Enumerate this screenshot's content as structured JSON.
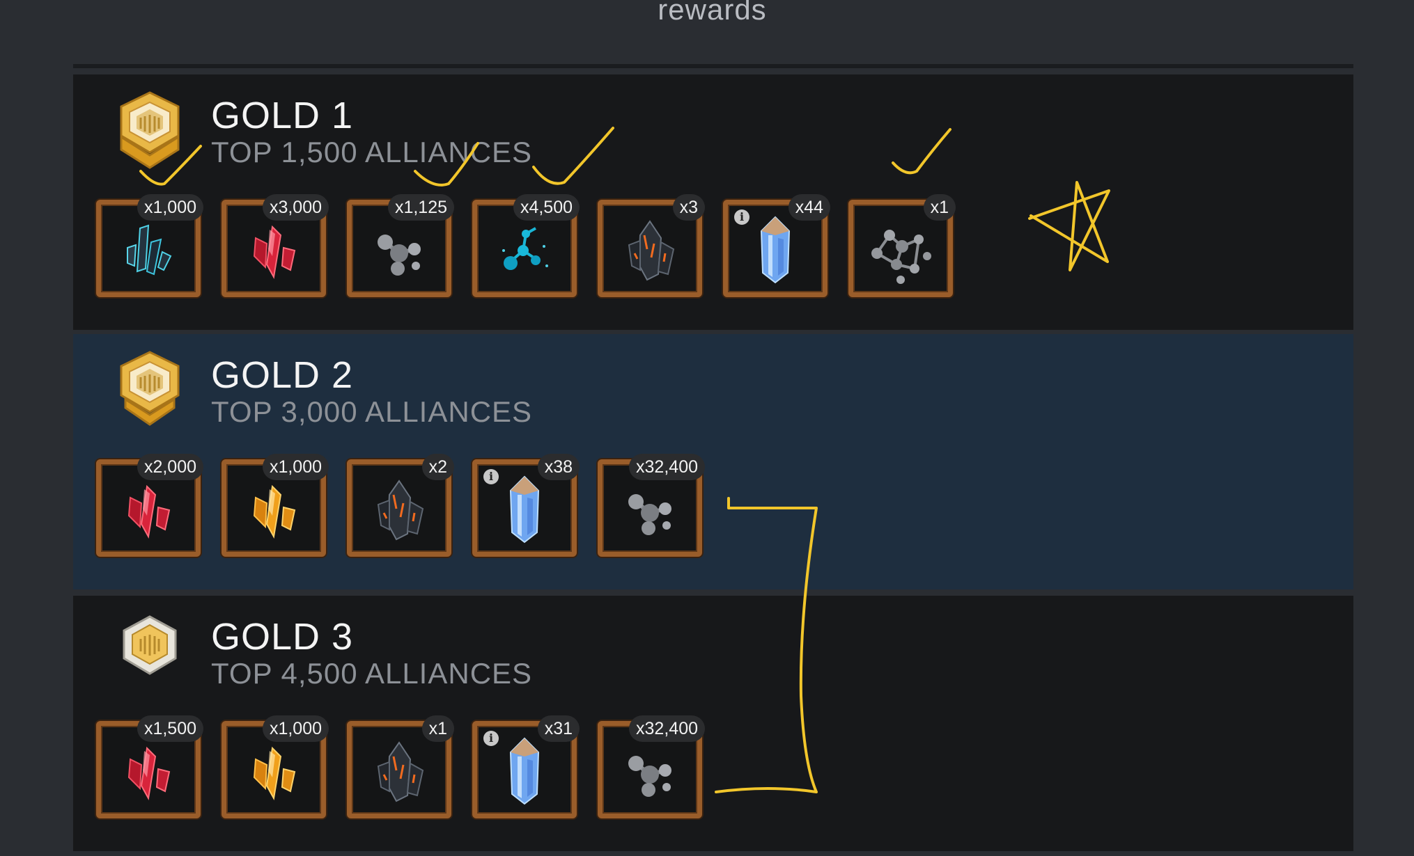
{
  "page": {
    "title": "rewards"
  },
  "tiers": [
    {
      "name": "GOLD 1",
      "subtitle": "TOP 1,500 ALLIANCES",
      "rewards": [
        {
          "item": "blue-shard-icon",
          "qty": "x1,000"
        },
        {
          "item": "red-crystal-shard-icon",
          "qty": "x3,000"
        },
        {
          "item": "gray-catalyst-icon",
          "qty": "x1,125"
        },
        {
          "item": "blue-catalyst-icon",
          "qty": "x4,500"
        },
        {
          "item": "dark-crystal-icon",
          "qty": "x3"
        },
        {
          "item": "blue-crystal-icon",
          "qty": "x44",
          "info": "i"
        },
        {
          "item": "molecule-icon",
          "qty": "x1"
        }
      ]
    },
    {
      "name": "GOLD 2",
      "subtitle": "TOP 3,000 ALLIANCES",
      "rewards": [
        {
          "item": "red-crystal-shard-icon",
          "qty": "x2,000"
        },
        {
          "item": "orange-crystal-shard-icon",
          "qty": "x1,000"
        },
        {
          "item": "dark-crystal-icon",
          "qty": "x2"
        },
        {
          "item": "blue-crystal-icon",
          "qty": "x38",
          "info": "i"
        },
        {
          "item": "gray-catalyst-icon",
          "qty": "x32,400"
        }
      ]
    },
    {
      "name": "GOLD 3",
      "subtitle": "TOP 4,500 ALLIANCES",
      "rewards": [
        {
          "item": "red-crystal-shard-icon",
          "qty": "x1,500"
        },
        {
          "item": "orange-crystal-shard-icon",
          "qty": "x1,000"
        },
        {
          "item": "dark-crystal-icon",
          "qty": "x1"
        },
        {
          "item": "blue-crystal-icon",
          "qty": "x31",
          "info": "i"
        },
        {
          "item": "gray-catalyst-icon",
          "qty": "x32,400"
        }
      ]
    }
  ],
  "colors": {
    "background": "#2a2d32",
    "panel_dark": "#17181a",
    "panel_blue": "#1e2e3f",
    "frame": "#9a5d2a",
    "annotation": "#f2c62b",
    "gold": "#e8b441"
  }
}
